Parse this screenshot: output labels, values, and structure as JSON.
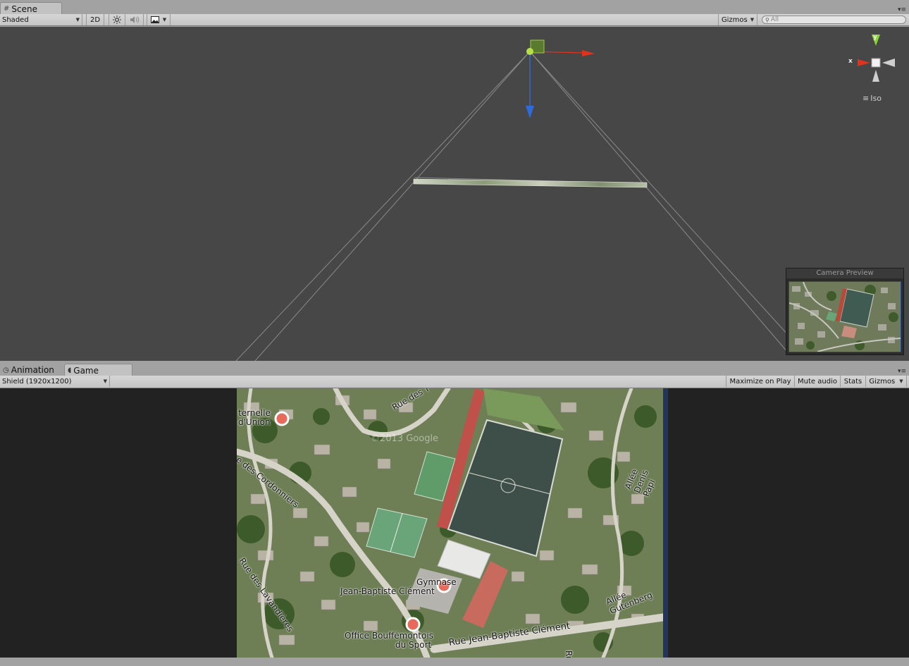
{
  "scene_tab": {
    "label": "Scene",
    "icon": "grid-icon"
  },
  "scene_toolbar": {
    "shading_mode": "Shaded",
    "mode_2d": "2D",
    "lighting_icon": "sun-icon",
    "audio_icon": "speaker-icon",
    "effects_icon": "image-icon",
    "gizmos_label": "Gizmos",
    "search_placeholder": "All"
  },
  "scene_gizmo": {
    "y_axis": "y",
    "x_axis": "x",
    "projection": "Iso"
  },
  "camera_preview": {
    "title": "Camera Preview"
  },
  "bottom_tabs": [
    {
      "label": "Animation",
      "icon": "clock-icon"
    },
    {
      "label": "Game",
      "icon": "pacman-icon"
    }
  ],
  "game_toolbar": {
    "resolution": "Shield (1920x1200)",
    "maximize_on_play": "Maximize on Play",
    "mute_audio": "Mute audio",
    "stats": "Stats",
    "gizmos": "Gizmos"
  },
  "map_labels": {
    "fraternelle": "ternelle",
    "union": "d'Union",
    "rue_top": "Rue des T",
    "watermark": "©2013 Google",
    "cordonniers": "e des Cordonniers",
    "lavandieres": "Rue des Lavandières",
    "gymnase_1": "Gymnase",
    "gymnase_2": "Jean-Baptiste Clément",
    "office_1": "Office Bouffémontois",
    "office_2": "du Sport",
    "rue_jbc": "Rue Jean-Baptiste Clément",
    "denis_papin": "Allée Denis Papi",
    "gutenberg": "Allée Gutenberg",
    "rue_right": "Ru"
  },
  "colors": {
    "scene_bg": "#474747",
    "game_bg": "#222222",
    "x_axis": "#e0321c",
    "y_axis": "#86d62d",
    "z_axis": "#2f6bd8"
  }
}
